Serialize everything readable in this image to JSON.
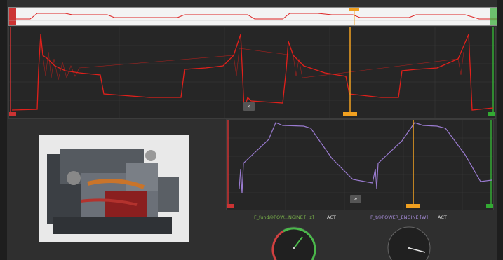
{
  "labels": {
    "chart1_label": "F_fund@POW...NGINE [Hz]",
    "chart2_label": "P_t@POWER_ENGINE [W]",
    "act": "ACT",
    "expand": "»"
  },
  "colors": {
    "signal_red": "#e0201b",
    "signal_purple": "#9a7bd0",
    "cursor_orange": "#f0a020",
    "gauge_green": "#4bb84b",
    "gauge_red": "#d04040"
  },
  "cursor": {
    "position_fraction": 0.71
  },
  "gauges": [
    {
      "label_key": "chart1_label",
      "needle_fraction": 0.62
    },
    {
      "label_key": "chart2_label",
      "needle_fraction": 0.38
    }
  ]
}
